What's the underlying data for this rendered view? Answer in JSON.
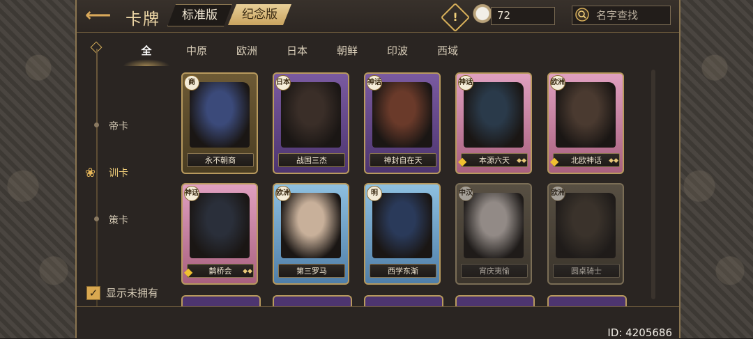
{
  "header": {
    "back_icon": "arrow-left-icon",
    "title": "卡牌",
    "tabs": [
      "标准版",
      "纪念版"
    ],
    "active_tab": "纪念版",
    "coin_value": "72",
    "search_placeholder": "名字查找"
  },
  "regions": [
    "全",
    "中原",
    "欧洲",
    "日本",
    "朝鲜",
    "印波",
    "西域"
  ],
  "active_region": "全",
  "sidebar": {
    "items": [
      "帝卡",
      "训卡",
      "策卡"
    ],
    "active": "训卡",
    "show_unowned_label": "显示未拥有",
    "show_unowned_checked": true
  },
  "cards": [
    {
      "name": "永不朝商",
      "badge": "商",
      "theme": "gold",
      "owned": true
    },
    {
      "name": "战国三杰",
      "badge": "日本",
      "theme": "purple",
      "owned": true
    },
    {
      "name": "神封自在天",
      "badge": "神话",
      "theme": "purple",
      "owned": true
    },
    {
      "name": "本源六天",
      "badge": "神话",
      "theme": "pink",
      "owned": true
    },
    {
      "name": "北欧神话",
      "badge": "欧洲",
      "theme": "pink",
      "owned": true
    },
    {
      "name": "鹊桥会",
      "badge": "神话",
      "theme": "pink",
      "owned": true
    },
    {
      "name": "第三罗马",
      "badge": "欧洲",
      "theme": "blue",
      "owned": true
    },
    {
      "name": "西学东渐",
      "badge": "明",
      "theme": "blue",
      "owned": true
    },
    {
      "name": "宵庆夷愉",
      "badge": "中汉",
      "theme": "gold",
      "owned": false
    },
    {
      "name": "圆桌骑士",
      "badge": "欧洲",
      "theme": "gold",
      "owned": false
    }
  ],
  "footer": {
    "id_text": "ID: 4205686"
  },
  "colors": {
    "accent_gold": "#d9a850",
    "frame": "#8a7550",
    "background": "#2a2522"
  }
}
